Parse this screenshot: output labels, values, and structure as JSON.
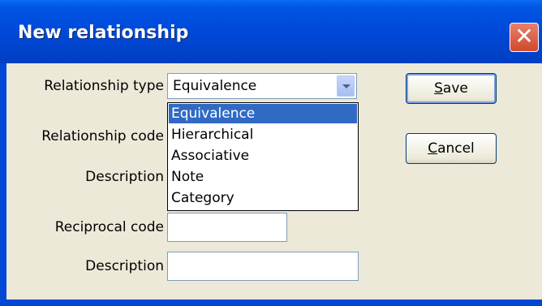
{
  "window": {
    "title": "New relationship",
    "close_glyph": "✕"
  },
  "form": {
    "relationship_type_label": "Relationship type",
    "relationship_type_value": "Equivalence",
    "relationship_code_label": "Relationship code",
    "description_label_1": "Description",
    "reciprocal_code_label": "Reciprocal code",
    "description_label_2": "Description"
  },
  "dropdown": {
    "options": [
      "Equivalence",
      "Hierarchical",
      "Associative",
      "Note",
      "Category"
    ],
    "selected": "Equivalence"
  },
  "buttons": {
    "save_mnemonic": "S",
    "save_rest": "ave",
    "cancel_mnemonic": "C",
    "cancel_rest": "ancel"
  },
  "colors": {
    "titlebar": "#0047d6",
    "selection": "#316ac5",
    "dialog_bg": "#ece9d8"
  },
  "icons": {
    "close": "close-icon",
    "combo_arrow": "chevron-down-icon"
  }
}
